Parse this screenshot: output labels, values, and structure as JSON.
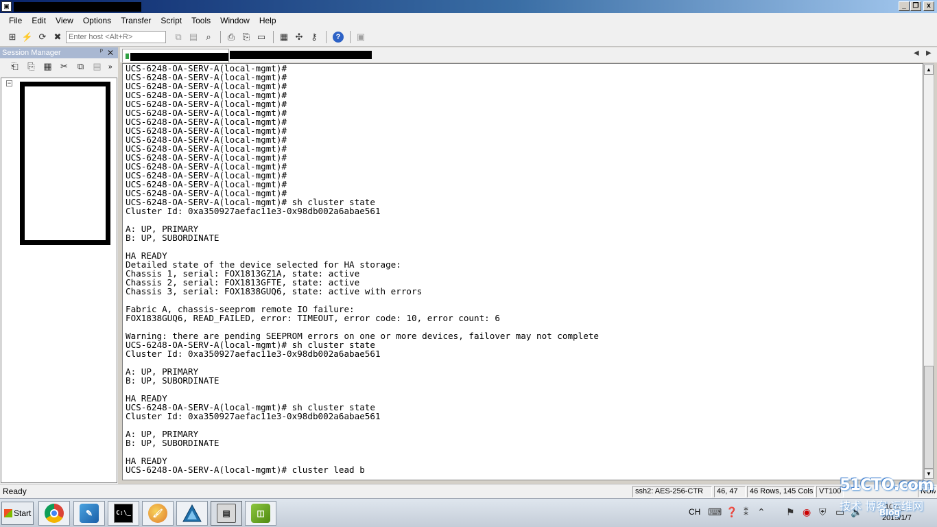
{
  "window": {
    "min_label": "_",
    "restore_label": "❐",
    "close_label": "x"
  },
  "menu": [
    "File",
    "Edit",
    "View",
    "Options",
    "Transfer",
    "Script",
    "Tools",
    "Window",
    "Help"
  ],
  "toolbar": {
    "host_placeholder": "Enter host <Alt+R>"
  },
  "session_manager": {
    "title": "Session Manager",
    "pin": "ᴾ",
    "close": "✕",
    "more": "»",
    "expander": "−"
  },
  "tabs": {
    "prev": "◀",
    "next": "▶"
  },
  "terminal": {
    "lines": [
      "UCS-6248-OA-SERV-A(local-mgmt)#",
      "UCS-6248-OA-SERV-A(local-mgmt)#",
      "UCS-6248-OA-SERV-A(local-mgmt)#",
      "UCS-6248-OA-SERV-A(local-mgmt)#",
      "UCS-6248-OA-SERV-A(local-mgmt)#",
      "UCS-6248-OA-SERV-A(local-mgmt)#",
      "UCS-6248-OA-SERV-A(local-mgmt)#",
      "UCS-6248-OA-SERV-A(local-mgmt)#",
      "UCS-6248-OA-SERV-A(local-mgmt)#",
      "UCS-6248-OA-SERV-A(local-mgmt)#",
      "UCS-6248-OA-SERV-A(local-mgmt)#",
      "UCS-6248-OA-SERV-A(local-mgmt)#",
      "UCS-6248-OA-SERV-A(local-mgmt)#",
      "UCS-6248-OA-SERV-A(local-mgmt)#",
      "UCS-6248-OA-SERV-A(local-mgmt)#",
      "UCS-6248-OA-SERV-A(local-mgmt)# sh cluster state",
      "Cluster Id: 0xa350927aefac11e3-0x98db002a6abae561",
      "",
      "A: UP, PRIMARY",
      "B: UP, SUBORDINATE",
      "",
      "HA READY",
      "Detailed state of the device selected for HA storage:",
      "Chassis 1, serial: FOX1813GZ1A, state: active",
      "Chassis 2, serial: FOX1813GFTE, state: active",
      "Chassis 3, serial: FOX1838GUQ6, state: active with errors",
      "",
      "Fabric A, chassis-seeprom remote IO failure:",
      "FOX1838GUQ6, READ_FAILED, error: TIMEOUT, error code: 10, error count: 6",
      "",
      "Warning: there are pending SEEPROM errors on one or more devices, failover may not complete",
      "UCS-6248-OA-SERV-A(local-mgmt)# sh cluster state",
      "Cluster Id: 0xa350927aefac11e3-0x98db002a6abae561",
      "",
      "A: UP, PRIMARY",
      "B: UP, SUBORDINATE",
      "",
      "HA READY",
      "UCS-6248-OA-SERV-A(local-mgmt)# sh cluster state",
      "Cluster Id: 0xa350927aefac11e3-0x98db002a6abae561",
      "",
      "A: UP, PRIMARY",
      "B: UP, SUBORDINATE",
      "",
      "HA READY",
      "UCS-6248-OA-SERV-A(local-mgmt)# cluster lead b"
    ]
  },
  "statusbar": {
    "ready": "Ready",
    "encryption": "ssh2: AES-256-CTR",
    "cursor_pos": "46,  47",
    "size": "46 Rows, 145 Cols",
    "emulation": "VT100",
    "caps": "NUM"
  },
  "taskbar": {
    "start_label": "Start",
    "cmd_label": "C:\\_"
  },
  "tray": {
    "lang": "CH",
    "time": "10:5_",
    "date": "2015/1/7"
  },
  "watermark": {
    "logo": "51CTO.com",
    "sub": "技术 博客 运维网",
    "url": "Blog"
  }
}
